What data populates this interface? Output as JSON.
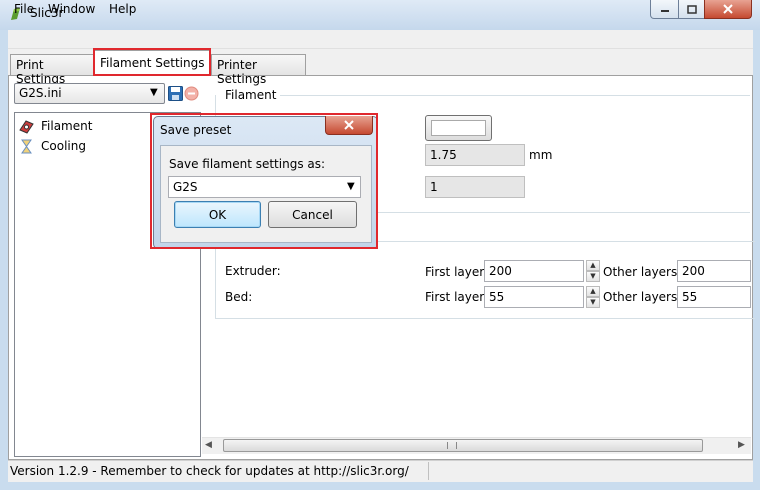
{
  "window": {
    "title": "Slic3r"
  },
  "menu": {
    "items": [
      "File",
      "Window",
      "Help"
    ]
  },
  "tabs": {
    "print": "Print Settings",
    "filament": "Filament Settings",
    "printer": "Printer Settings"
  },
  "left": {
    "preset": "G2S.ini",
    "tree": [
      {
        "label": "Filament",
        "icon": "spool-icon"
      },
      {
        "label": "Cooling",
        "icon": "hourglass-icon"
      }
    ]
  },
  "filament_group": {
    "title": "Filament",
    "diameter": "1.75",
    "diameter_unit": "mm",
    "extrusion_multiplier": "1"
  },
  "temperature_group": {
    "extruder_label": "Extruder:",
    "bed_label": "Bed:",
    "first_layer_label": "First layer:",
    "other_layers_label": "Other layers:",
    "extruder_first": "200",
    "extruder_other": "200",
    "bed_first": "55",
    "bed_other": "55"
  },
  "status": {
    "text": "Version 1.2.9 - Remember to check for updates at http://slic3r.org/"
  },
  "dialog": {
    "title": "Save preset",
    "prompt": "Save filament settings as:",
    "value": "G2S",
    "ok": "OK",
    "cancel": "Cancel"
  },
  "colors": {
    "highlight": "#e0282e",
    "dialog_frame": "#c2d5ea"
  }
}
